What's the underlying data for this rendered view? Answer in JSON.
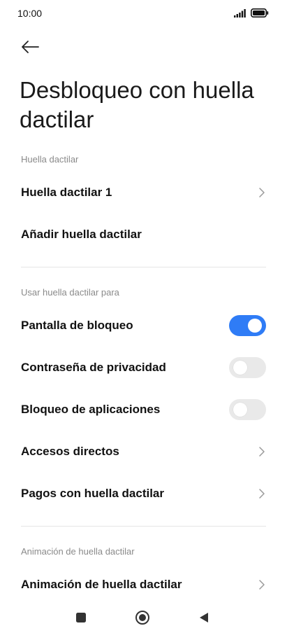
{
  "status_bar": {
    "time": "10:00"
  },
  "header": {
    "back_icon": "arrow-left-icon",
    "title": "Desbloqueo con huella dactilar"
  },
  "sections": [
    {
      "header": "Huella dactilar",
      "items": [
        {
          "label": "Huella dactilar 1",
          "control": "chevron"
        },
        {
          "label": "Añadir huella dactilar",
          "control": "none"
        }
      ]
    },
    {
      "header": "Usar huella dactilar para",
      "items": [
        {
          "label": "Pantalla de bloqueo",
          "control": "toggle",
          "on": true
        },
        {
          "label": "Contraseña de privacidad",
          "control": "toggle",
          "on": false
        },
        {
          "label": "Bloqueo de aplicaciones",
          "control": "toggle",
          "on": false
        },
        {
          "label": "Accesos directos",
          "control": "chevron"
        },
        {
          "label": "Pagos con huella dactilar",
          "control": "chevron"
        }
      ]
    },
    {
      "header": "Animación de huella dactilar",
      "items": [
        {
          "label": "Animación de huella dactilar",
          "control": "chevron"
        }
      ]
    }
  ],
  "nav_bar": {
    "recents_icon": "square-icon",
    "home_icon": "circle-icon",
    "back_icon": "triangle-back-icon"
  },
  "colors": {
    "accent": "#2f7cf6",
    "toggle_off": "#e9e9e9",
    "section_header": "#8a8a8a",
    "divider": "#e6e6e6"
  }
}
